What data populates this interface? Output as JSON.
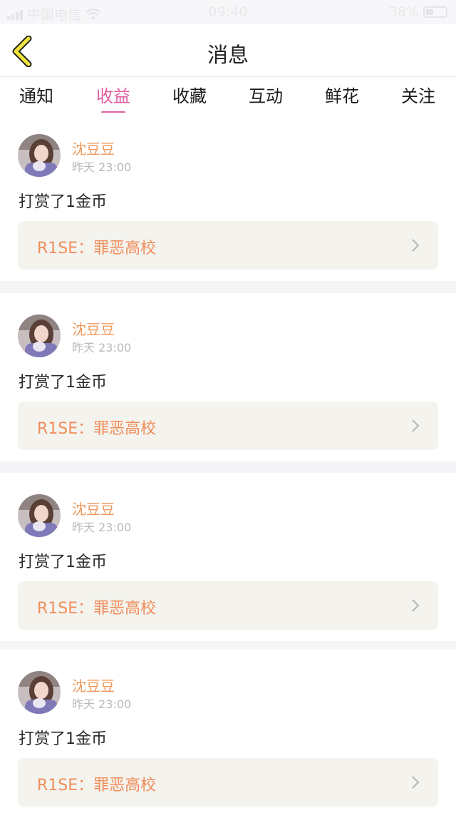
{
  "status_bar": {
    "carrier": "中国电信",
    "time": "09:40",
    "battery": "38%",
    "battery_level": 0.38
  },
  "nav": {
    "back_icon": "chevron-left-icon",
    "title": "消息"
  },
  "tabs": [
    {
      "label": "通知",
      "active": false
    },
    {
      "label": "收益",
      "active": true
    },
    {
      "label": "收藏",
      "active": false
    },
    {
      "label": "互动",
      "active": false
    },
    {
      "label": "鲜花",
      "active": false
    },
    {
      "label": "关注",
      "active": false
    }
  ],
  "messages": [
    {
      "user": "沈豆豆",
      "time": "昨天 23:00",
      "text": "打赏了1金币",
      "work": "R1SE：罪恶高校"
    },
    {
      "user": "沈豆豆",
      "time": "昨天 23:00",
      "text": "打赏了1金币",
      "work": "R1SE：罪恶高校"
    },
    {
      "user": "沈豆豆",
      "time": "昨天 23:00",
      "text": "打赏了1金币",
      "work": "R1SE：罪恶高校"
    },
    {
      "user": "沈豆豆",
      "time": "昨天 23:00",
      "text": "打赏了1金币",
      "work": "R1SE：罪恶高校"
    }
  ],
  "colors": {
    "accent": "#e25d9f",
    "username": "#ef9a5e",
    "link_text": "#ef8e5c",
    "back_icon": "#f2e43c"
  }
}
